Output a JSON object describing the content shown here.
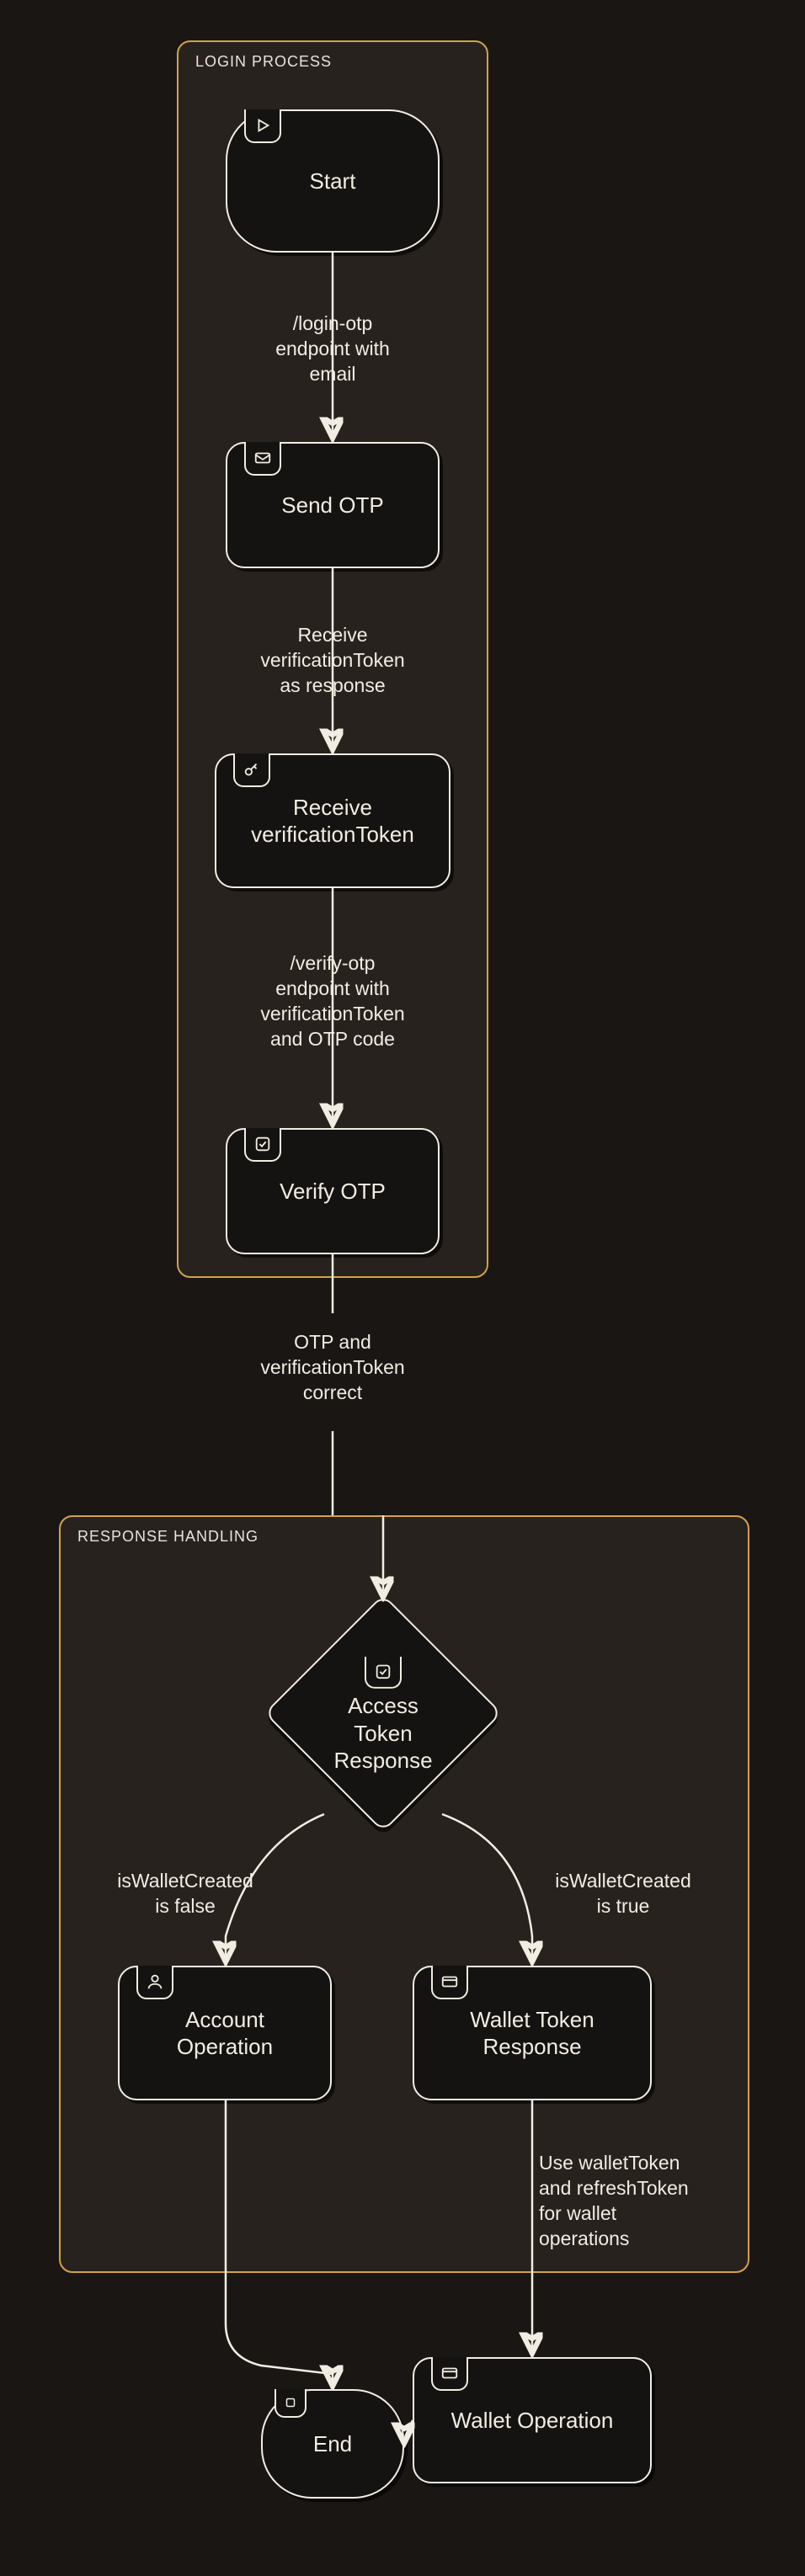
{
  "groups": {
    "login": {
      "label": "LOGIN PROCESS"
    },
    "response": {
      "label": "RESPONSE HANDLING"
    }
  },
  "nodes": {
    "start": {
      "label": "Start",
      "icon": "play"
    },
    "send_otp": {
      "label": "Send OTP",
      "icon": "mail"
    },
    "recv_token": {
      "label": "Receive\nverificationToken",
      "icon": "key"
    },
    "verify_otp": {
      "label": "Verify OTP",
      "icon": "check-square"
    },
    "access_token": {
      "label": "Access\nToken\nResponse",
      "icon": "check-square"
    },
    "account_op": {
      "label": "Account\nOperation",
      "icon": "user"
    },
    "wallet_token": {
      "label": "Wallet Token\nResponse",
      "icon": "card"
    },
    "wallet_op": {
      "label": "Wallet Operation",
      "icon": "card"
    },
    "end": {
      "label": "End",
      "icon": "stop"
    }
  },
  "edges": {
    "e1": "/login-otp\nendpoint with\nemail",
    "e2": "Receive\nverificationToken\nas response",
    "e3": "/verify-otp\nendpoint with\nverificationToken\nand OTP code",
    "e4": "OTP and\nverificationToken\ncorrect",
    "e5": "isWalletCreated\nis false",
    "e6": "isWalletCreated\nis true",
    "e7": "Use walletToken\nand refreshToken\nfor wallet\noperations"
  },
  "chart_data": {
    "type": "flowchart",
    "groups": [
      {
        "id": "login",
        "label": "LOGIN PROCESS",
        "nodes": [
          "start",
          "send_otp",
          "recv_token",
          "verify_otp"
        ]
      },
      {
        "id": "response",
        "label": "RESPONSE HANDLING",
        "nodes": [
          "access_token",
          "account_op",
          "wallet_token",
          "wallet_op"
        ]
      }
    ],
    "nodes": [
      {
        "id": "start",
        "label": "Start",
        "shape": "terminator",
        "icon": "play"
      },
      {
        "id": "send_otp",
        "label": "Send OTP",
        "shape": "process",
        "icon": "mail"
      },
      {
        "id": "recv_token",
        "label": "Receive verificationToken",
        "shape": "process",
        "icon": "key"
      },
      {
        "id": "verify_otp",
        "label": "Verify OTP",
        "shape": "process",
        "icon": "check-square"
      },
      {
        "id": "access_token",
        "label": "Access Token Response",
        "shape": "decision",
        "icon": "check-square"
      },
      {
        "id": "account_op",
        "label": "Account Operation",
        "shape": "process",
        "icon": "user"
      },
      {
        "id": "wallet_token",
        "label": "Wallet Token Response",
        "shape": "process",
        "icon": "card"
      },
      {
        "id": "wallet_op",
        "label": "Wallet Operation",
        "shape": "process",
        "icon": "card"
      },
      {
        "id": "end",
        "label": "End",
        "shape": "terminator",
        "icon": "stop"
      }
    ],
    "edges": [
      {
        "from": "start",
        "to": "send_otp",
        "label": "/login-otp endpoint with email"
      },
      {
        "from": "send_otp",
        "to": "recv_token",
        "label": "Receive verificationToken as response"
      },
      {
        "from": "recv_token",
        "to": "verify_otp",
        "label": "/verify-otp endpoint with verificationToken and OTP code"
      },
      {
        "from": "verify_otp",
        "to": "access_token",
        "label": "OTP and verificationToken correct"
      },
      {
        "from": "access_token",
        "to": "account_op",
        "label": "isWalletCreated is false"
      },
      {
        "from": "access_token",
        "to": "wallet_token",
        "label": "isWalletCreated is true"
      },
      {
        "from": "wallet_token",
        "to": "wallet_op",
        "label": "Use walletToken and refreshToken for wallet operations"
      },
      {
        "from": "account_op",
        "to": "end",
        "label": ""
      },
      {
        "from": "wallet_op",
        "to": "end",
        "label": ""
      }
    ]
  }
}
